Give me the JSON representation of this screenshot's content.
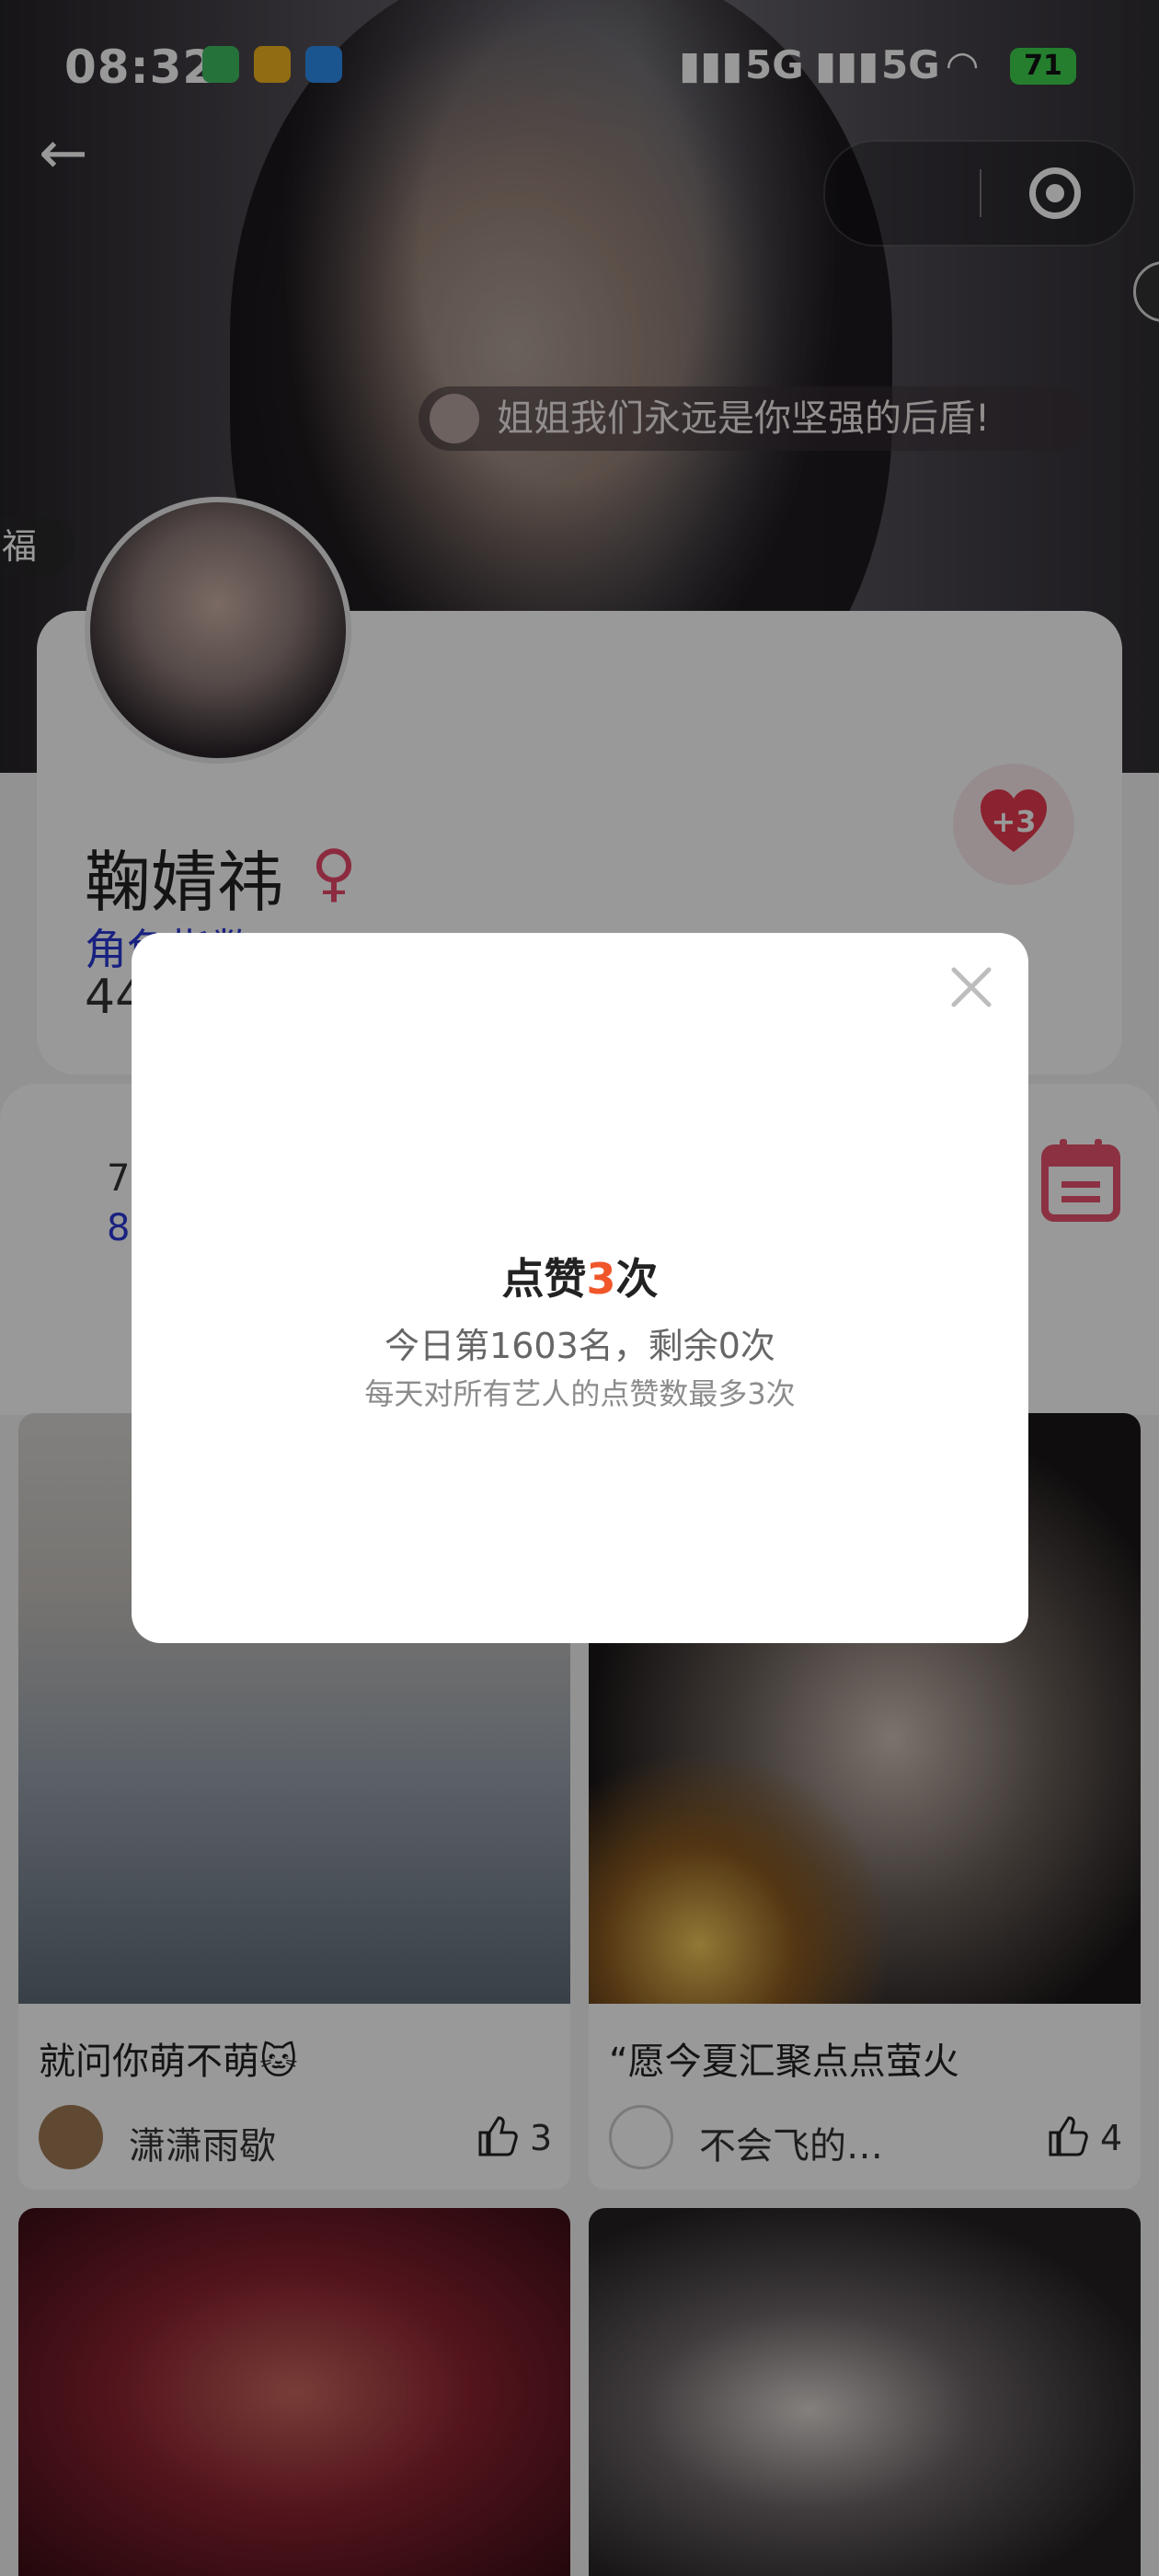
{
  "status_bar": {
    "time": "08:32",
    "network_1": "5G",
    "network_2": "5G",
    "battery": "71"
  },
  "header": {
    "danmaku": "姐姐我们永远是你坚强的后盾!",
    "side_tag": "福"
  },
  "profile": {
    "name": "鞠婧祎",
    "rank_label": "角色指数",
    "rank_partial": "44",
    "like_badge": "+3"
  },
  "stats": {
    "line1": "7",
    "line2": "8"
  },
  "modal": {
    "title_prefix": "点赞",
    "title_count": "3",
    "title_suffix": "次",
    "rank_text": "今日第1603名，剩余0次",
    "note": "每天对所有艺人的点赞数最多3次"
  },
  "feed": [
    {
      "title": "就问你萌不萌🐱",
      "user": "潇潇雨歇",
      "likes": "3"
    },
    {
      "title": "“愿今夏汇聚点点萤火",
      "user": "不会飞的…",
      "likes": "4"
    }
  ]
}
